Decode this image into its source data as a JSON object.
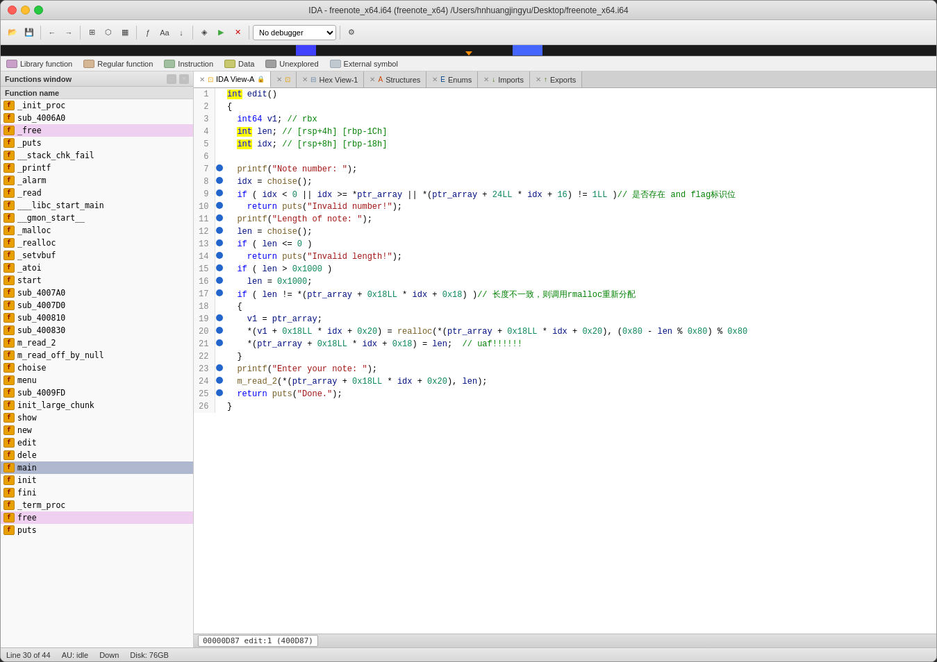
{
  "window": {
    "title": "IDA - freenote_x64.i64 (freenote_x64) /Users/hnhuangjingyu/Desktop/freenote_x64.i64"
  },
  "legend": {
    "items": [
      {
        "label": "Library function",
        "color": "#c8a0c8"
      },
      {
        "label": "Regular function",
        "color": "#d4b896"
      },
      {
        "label": "Instruction",
        "color": "#a0c0a0"
      },
      {
        "label": "Data",
        "color": "#c8c870"
      },
      {
        "label": "Unexplored",
        "color": "#a0a0a0"
      },
      {
        "label": "External symbol",
        "color": "#c0c8d0"
      }
    ]
  },
  "functions_panel": {
    "title": "Functions window",
    "col_header": "Function name",
    "items": [
      {
        "name": "_init_proc",
        "highlighted": false
      },
      {
        "name": "sub_4006A0",
        "highlighted": false
      },
      {
        "name": "_free",
        "highlighted": true
      },
      {
        "name": "_puts",
        "highlighted": false
      },
      {
        "name": "__stack_chk_fail",
        "highlighted": false
      },
      {
        "name": "_printf",
        "highlighted": false
      },
      {
        "name": "_alarm",
        "highlighted": false
      },
      {
        "name": "_read",
        "highlighted": false
      },
      {
        "name": "___libc_start_main",
        "highlighted": false
      },
      {
        "name": "__gmon_start__",
        "highlighted": false
      },
      {
        "name": "_malloc",
        "highlighted": false
      },
      {
        "name": "_realloc",
        "highlighted": false
      },
      {
        "name": "_setvbuf",
        "highlighted": false
      },
      {
        "name": "_atoi",
        "highlighted": false
      },
      {
        "name": "start",
        "highlighted": false
      },
      {
        "name": "sub_4007A0",
        "highlighted": false
      },
      {
        "name": "sub_4007D0",
        "highlighted": false
      },
      {
        "name": "sub_400810",
        "highlighted": false
      },
      {
        "name": "sub_400830",
        "highlighted": false
      },
      {
        "name": "m_read_2",
        "highlighted": false
      },
      {
        "name": "m_read_off_by_null",
        "highlighted": false
      },
      {
        "name": "choise",
        "highlighted": false
      },
      {
        "name": "menu",
        "highlighted": false
      },
      {
        "name": "sub_4009FD",
        "highlighted": false
      },
      {
        "name": "init_large_chunk",
        "highlighted": false
      },
      {
        "name": "show",
        "highlighted": false
      },
      {
        "name": "new",
        "highlighted": false
      },
      {
        "name": "edit",
        "highlighted": false
      },
      {
        "name": "dele",
        "highlighted": false
      },
      {
        "name": "main",
        "selected": true
      },
      {
        "name": "init",
        "highlighted": false
      },
      {
        "name": "fini",
        "highlighted": false
      },
      {
        "name": "_term_proc",
        "highlighted": false
      },
      {
        "name": "free",
        "highlighted": true
      },
      {
        "name": "puts",
        "highlighted": false
      }
    ]
  },
  "tabs": [
    {
      "label": "IDA View-A",
      "active": true,
      "closeable": true
    },
    {
      "label": "",
      "active": false,
      "closeable": true
    },
    {
      "label": "Hex View-1",
      "active": false,
      "closeable": true
    },
    {
      "label": "Structures",
      "active": false,
      "closeable": true
    },
    {
      "label": "Enums",
      "active": false,
      "closeable": true
    },
    {
      "label": "Imports",
      "active": false,
      "closeable": true
    },
    {
      "label": "Exports",
      "active": false,
      "closeable": true
    }
  ],
  "code": {
    "lines": [
      {
        "num": 1,
        "bp": false,
        "html": "<span class='kw-yellow'>int</span><span class='var'> edit</span><span class='op'>()</span>"
      },
      {
        "num": 2,
        "bp": false,
        "html": "<span class='op'>{</span>"
      },
      {
        "num": 3,
        "bp": false,
        "html": "  <span class='kw'>int64</span> <span class='var'>v1</span><span class='op'>;</span> <span class='comment'>// rbx</span>"
      },
      {
        "num": 4,
        "bp": false,
        "html": "  <span class='kw-yellow'>int</span> <span class='var'>len</span><span class='op'>;</span> <span class='comment'>// [rsp+4h] [rbp-1Ch]</span>"
      },
      {
        "num": 5,
        "bp": false,
        "html": "  <span class='kw-yellow'>int</span> <span class='var'>idx</span><span class='op'>;</span> <span class='comment'>// [rsp+8h] [rbp-18h]</span>"
      },
      {
        "num": 6,
        "bp": false,
        "html": ""
      },
      {
        "num": 7,
        "bp": true,
        "html": "  <span class='func-call'>printf</span><span class='op'>(</span><span class='str'>\"Note number: \"</span><span class='op'>);</span>"
      },
      {
        "num": 8,
        "bp": true,
        "html": "  <span class='var'>idx</span> <span class='op'>=</span> <span class='func-call'>choise</span><span class='op'>();</span>"
      },
      {
        "num": 9,
        "bp": true,
        "html": "  <span class='kw'>if</span> <span class='op'>(</span> <span class='var'>idx</span> <span class='op'>&lt;</span> <span class='num'>0</span> <span class='op'>||</span> <span class='var'>idx</span> <span class='op'>&gt;=</span> <span class='op'>*</span><span class='var'>ptr_array</span> <span class='op'>||</span> <span class='op'>*(</span><span class='var'>ptr_array</span> <span class='op'>+</span> <span class='num'>24LL</span> <span class='op'>*</span> <span class='var'>idx</span> <span class='op'>+</span> <span class='num'>16</span><span class='op'>)</span> <span class='op'>!=</span> <span class='num'>1LL</span> <span class='op'>)</span><span class='comment'>// 是否存在 and flag标识位</span>"
      },
      {
        "num": 10,
        "bp": true,
        "html": "    <span class='kw'>return</span> <span class='func-call'>puts</span><span class='op'>(</span><span class='str'>\"Invalid number!\"</span><span class='op'>);</span>"
      },
      {
        "num": 11,
        "bp": true,
        "html": "  <span class='func-call'>printf</span><span class='op'>(</span><span class='str'>\"Length of note: \"</span><span class='op'>);</span>"
      },
      {
        "num": 12,
        "bp": true,
        "html": "  <span class='var'>len</span> <span class='op'>=</span> <span class='func-call'>choise</span><span class='op'>();</span>"
      },
      {
        "num": 13,
        "bp": true,
        "html": "  <span class='kw'>if</span> <span class='op'>(</span> <span class='var'>len</span> <span class='op'>&lt;=</span> <span class='num'>0</span> <span class='op'>)</span>"
      },
      {
        "num": 14,
        "bp": true,
        "html": "    <span class='kw'>return</span> <span class='func-call'>puts</span><span class='op'>(</span><span class='str'>\"Invalid length!\"</span><span class='op'>);</span>"
      },
      {
        "num": 15,
        "bp": true,
        "html": "  <span class='kw'>if</span> <span class='op'>(</span> <span class='var'>len</span> <span class='op'>&gt;</span> <span class='num'>0x1000</span> <span class='op'>)</span>"
      },
      {
        "num": 16,
        "bp": true,
        "html": "    <span class='var'>len</span> <span class='op'>=</span> <span class='num'>0x1000</span><span class='op'>;</span>"
      },
      {
        "num": 17,
        "bp": true,
        "html": "  <span class='kw'>if</span> <span class='op'>(</span> <span class='var'>len</span> <span class='op'>!=</span> <span class='op'>*(</span><span class='var'>ptr_array</span> <span class='op'>+</span> <span class='num'>0x18LL</span> <span class='op'>*</span> <span class='var'>idx</span> <span class='op'>+</span> <span class='num'>0x18</span><span class='op'>)</span> <span class='op'>)</span><span class='comment'>// 长度不一致，则调用rmalloc重新分配</span>"
      },
      {
        "num": 18,
        "bp": false,
        "html": "  <span class='op'>{</span>"
      },
      {
        "num": 19,
        "bp": true,
        "html": "    <span class='var'>v1</span> <span class='op'>=</span> <span class='var'>ptr_array</span><span class='op'>;</span>"
      },
      {
        "num": 20,
        "bp": true,
        "html": "    <span class='op'>*(</span><span class='var'>v1</span> <span class='op'>+</span> <span class='num'>0x18LL</span> <span class='op'>*</span> <span class='var'>idx</span> <span class='op'>+</span> <span class='num'>0x20</span><span class='op'>)</span> <span class='op'>=</span> <span class='func-call'>realloc</span><span class='op'>(*(</span><span class='var'>ptr_array</span> <span class='op'>+</span> <span class='num'>0x18LL</span> <span class='op'>*</span> <span class='var'>idx</span> <span class='op'>+</span> <span class='num'>0x20</span><span class='op'>),</span> <span class='op'>(</span><span class='num'>0x80</span> <span class='op'>-</span> <span class='var'>len</span> <span class='op'>%</span> <span class='num'>0x80</span><span class='op'>)</span> <span class='op'>%</span> <span class='num'>0x80</span>"
      },
      {
        "num": 21,
        "bp": true,
        "html": "    <span class='op'>*(</span><span class='var'>ptr_array</span> <span class='op'>+</span> <span class='num'>0x18LL</span> <span class='op'>*</span> <span class='var'>idx</span> <span class='op'>+</span> <span class='num'>0x18</span><span class='op'>)</span> <span class='op'>=</span> <span class='var'>len</span><span class='op'>;</span>  <span class='comment'>// uaf!!!!!!</span>"
      },
      {
        "num": 22,
        "bp": false,
        "html": "  <span class='op'>}</span>"
      },
      {
        "num": 23,
        "bp": true,
        "html": "  <span class='func-call'>printf</span><span class='op'>(</span><span class='str'>\"Enter your note: \"</span><span class='op'>);</span>"
      },
      {
        "num": 24,
        "bp": true,
        "html": "  <span class='func-call'>m_read_2</span><span class='op'>(*(</span><span class='var'>ptr_array</span> <span class='op'>+</span> <span class='num'>0x18LL</span> <span class='op'>*</span> <span class='var'>idx</span> <span class='op'>+</span> <span class='num'>0x20</span><span class='op'>),</span> <span class='var'>len</span><span class='op'>);</span>"
      },
      {
        "num": 25,
        "bp": true,
        "html": "  <span class='kw'>return</span> <span class='func-call'>puts</span><span class='op'>(</span><span class='str'>\"Done.\"</span><span class='op'>);</span>"
      },
      {
        "num": 26,
        "bp": false,
        "html": "<span class='op'>}</span>"
      }
    ]
  },
  "statusbar": {
    "addr": "00000D87 edit:1 (400D87)"
  },
  "bottombar": {
    "line": "Line 30 of 44",
    "au": "AU: idle",
    "down": "Down",
    "disk": "Disk: 76GB"
  },
  "debugger": {
    "label": "No debugger"
  }
}
